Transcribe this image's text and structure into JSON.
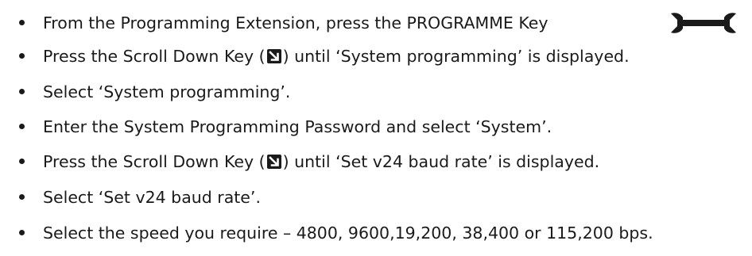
{
  "steps": [
    {
      "pre": "From the Programming Extension, press the PROGRAMME Key",
      "post": ""
    },
    {
      "pre": "Press the Scroll Down Key (",
      "post": ") until ‘System programming’ is displayed."
    },
    {
      "pre": "Select ‘System programming’.",
      "post": ""
    },
    {
      "pre": "Enter the System Programming Password and select ‘System’.",
      "post": ""
    },
    {
      "pre": "Press the Scroll Down Key (",
      "post": ") until ‘Set v24 baud rate’ is displayed."
    },
    {
      "pre": "Select ‘Set v24 baud rate’.",
      "post": ""
    },
    {
      "pre": "Select the speed you require – 4800, 9600,19,200, 38,400 or 115,200 bps.",
      "post": ""
    }
  ],
  "icons": {
    "programme_key": "wrench-icon",
    "scroll_down_key": "scroll-down-arrow-icon"
  },
  "colors": {
    "text": "#1a1a1a",
    "background": "#ffffff"
  }
}
